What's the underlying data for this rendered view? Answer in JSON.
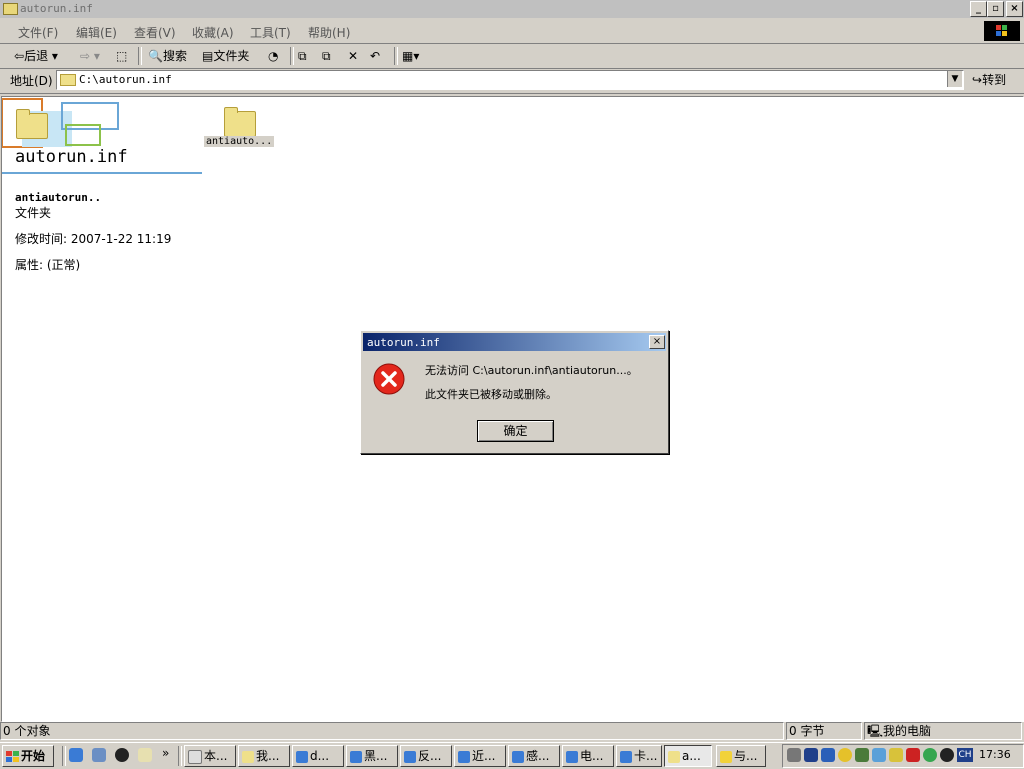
{
  "window": {
    "title": "autorun.inf",
    "menu": [
      "文件(F)",
      "编辑(E)",
      "查看(V)",
      "收藏(A)",
      "工具(T)",
      "帮助(H)"
    ],
    "toolbar": {
      "back": "后退",
      "search": "搜索",
      "folders": "文件夹"
    },
    "address_label": "地址(D)",
    "address_value": "C:\\autorun.inf",
    "go_label": "转到"
  },
  "content": {
    "folder_title": "autorun.inf",
    "folder_item_label": "antiauto...",
    "details": {
      "name": "antiautorun..",
      "type": "文件夹",
      "modified": "修改时间: 2007-1-22 11:19",
      "attributes": "属性: (正常)"
    }
  },
  "dialog": {
    "title": "autorun.inf",
    "message1": "无法访问 C:\\autorun.inf\\antiautorun...。",
    "message2": "此文件夹已被移动或删除。",
    "ok": "确定"
  },
  "status": {
    "objects": "0 个对象",
    "size": "0 字节",
    "location": "我的电脑"
  },
  "taskbar": {
    "start": "开始",
    "buttons": [
      "本...",
      "我...",
      "d...",
      "黑...",
      "反...",
      "近...",
      "感...",
      "电...",
      "卡...",
      "a...",
      "与..."
    ],
    "ime": "CH",
    "clock": "17:36"
  }
}
